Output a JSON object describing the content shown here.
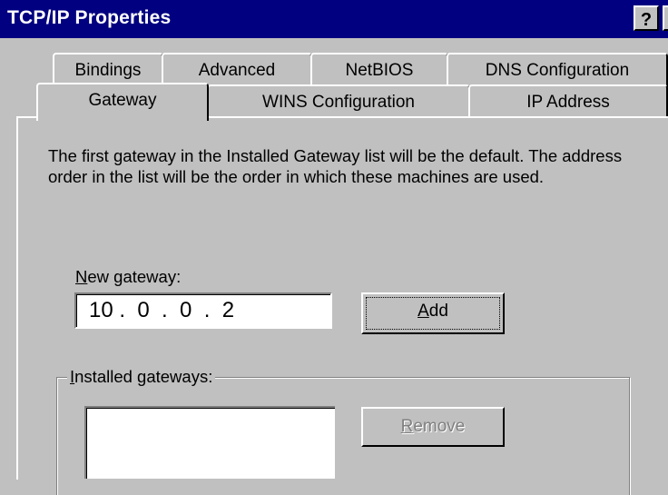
{
  "window": {
    "title": "TCP/IP Properties",
    "help_label": "?",
    "close_label": "×"
  },
  "tabs": {
    "row1": [
      "Bindings",
      "Advanced",
      "NetBIOS",
      "DNS Configuration"
    ],
    "row2": [
      "Gateway",
      "WINS Configuration",
      "IP Address"
    ],
    "active": "Gateway"
  },
  "description": "The first gateway in the Installed Gateway list will be the default. The address order in the list will be the order in which these machines are used.",
  "new_gateway": {
    "label_key": "N",
    "label_rest": "ew gateway:",
    "value": "10 .  0  .  0  .  2",
    "add_key": "A",
    "add_rest": "dd"
  },
  "installed": {
    "label_key": "I",
    "label_rest": "nstalled gateways:",
    "items": [],
    "remove_key": "R",
    "remove_rest": "emove"
  }
}
